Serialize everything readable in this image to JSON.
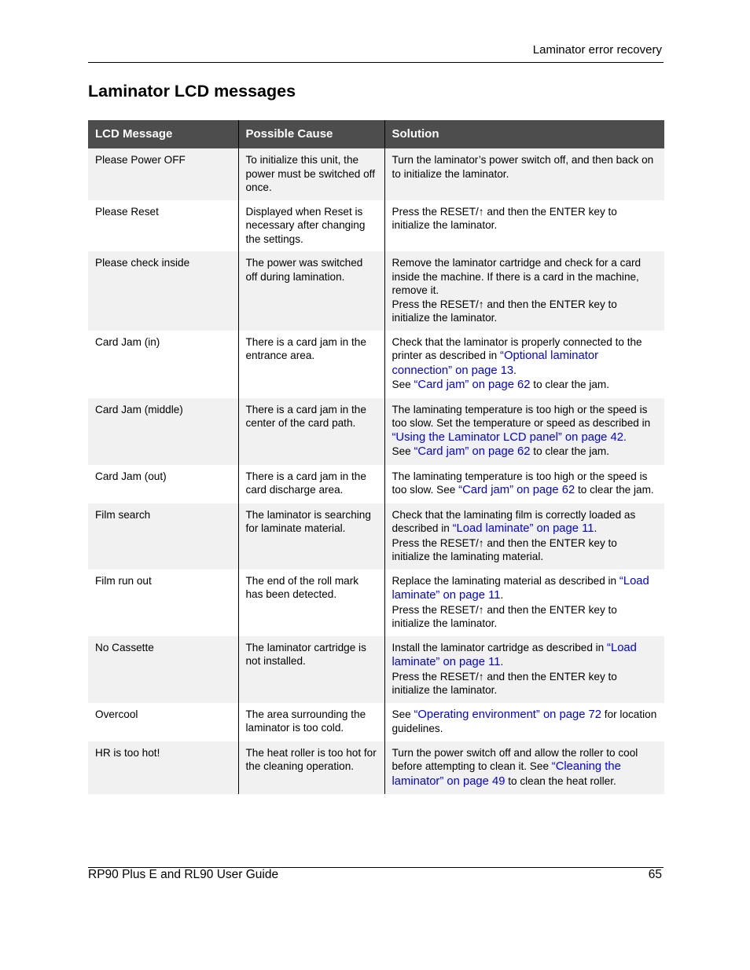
{
  "header": {
    "section": "Laminator error recovery"
  },
  "title": "Laminator LCD messages",
  "table": {
    "columns": [
      "LCD Message",
      "Possible Cause",
      "Solution"
    ],
    "rows": [
      {
        "message": "Please Power OFF",
        "cause": "To initialize this unit, the power must be switched off once.",
        "solution": [
          [
            {
              "t": "Turn the laminator’s power switch off, and then back on to initialize the laminator."
            }
          ]
        ]
      },
      {
        "message": "Please Reset",
        "cause": "Displayed when Reset is necessary after changing the settings.",
        "solution": [
          [
            {
              "t": "Press the RESET/↑ and then the ENTER key to initialize the laminator."
            }
          ]
        ]
      },
      {
        "message": "Please check inside",
        "cause": "The power was switched off during lamination.",
        "solution": [
          [
            {
              "t": "Remove the laminator cartridge and check for a card inside the machine. If there is a card in the machine, remove it."
            }
          ],
          [
            {
              "t": "Press the RESET/↑ and then the ENTER key to initialize the laminator."
            }
          ]
        ]
      },
      {
        "message": "Card Jam (in)",
        "cause": "There is a card jam in the entrance area.",
        "solution": [
          [
            {
              "t": "Check that the laminator is properly connected to the printer as described in "
            },
            {
              "t": "“Optional laminator connection” on page 13",
              "link": true
            },
            {
              "t": "."
            }
          ],
          [
            {
              "t": "See "
            },
            {
              "t": "“Card jam” on page 62",
              "link": true
            },
            {
              "t": " to clear the jam."
            }
          ]
        ]
      },
      {
        "message": "Card Jam (middle)",
        "cause": "There is a card jam in the center of the card path.",
        "solution": [
          [
            {
              "t": "The laminating temperature is too high or the speed is too slow. Set the temperature or speed as described in "
            },
            {
              "t": "“Using the Laminator LCD panel” on page 42",
              "link": true
            },
            {
              "t": "."
            }
          ],
          [
            {
              "t": "See "
            },
            {
              "t": "“Card jam” on page 62",
              "link": true
            },
            {
              "t": " to clear the jam."
            }
          ]
        ]
      },
      {
        "message": "Card Jam (out)",
        "cause": "There is a card jam in the card discharge area.",
        "solution": [
          [
            {
              "t": "The laminating temperature is too high or the speed is too slow. See "
            },
            {
              "t": "“Card jam” on page 62",
              "link": true
            },
            {
              "t": " to clear the jam."
            }
          ]
        ]
      },
      {
        "message": "Film search",
        "cause": "The laminator is searching for laminate material.",
        "solution": [
          [
            {
              "t": "Check that the laminating film is correctly loaded as described in "
            },
            {
              "t": "“Load laminate” on page 11",
              "link": true
            },
            {
              "t": "."
            }
          ],
          [
            {
              "t": "Press the RESET/↑ and then the ENTER key to initialize the laminating material."
            }
          ]
        ]
      },
      {
        "message": "Film run out",
        "cause": "The end of the roll mark has been detected.",
        "solution": [
          [
            {
              "t": "Replace the laminating material as described in "
            },
            {
              "t": "“Load laminate” on page 11",
              "link": true
            },
            {
              "t": "."
            }
          ],
          [
            {
              "t": "Press the RESET/↑ and then the ENTER key to initialize the laminator."
            }
          ]
        ]
      },
      {
        "message": "No Cassette",
        "cause": "The laminator cartridge is not installed.",
        "solution": [
          [
            {
              "t": "Install the laminator cartridge as described in "
            },
            {
              "t": "“Load laminate” on page 11",
              "link": true
            },
            {
              "t": "."
            }
          ],
          [
            {
              "t": "Press the RESET/↑ and then the ENTER key to initialize the laminator."
            }
          ]
        ]
      },
      {
        "message": "Overcool",
        "cause": "The area surrounding the laminator is too cold.",
        "solution": [
          [
            {
              "t": "See "
            },
            {
              "t": "“Operating environment” on page 72",
              "link": true
            },
            {
              "t": " for location guidelines."
            }
          ]
        ]
      },
      {
        "message": "HR is too hot!",
        "cause": "The heat roller is too hot for the cleaning operation.",
        "solution": [
          [
            {
              "t": "Turn the power switch off and allow the roller to cool before attempting to clean it. See "
            },
            {
              "t": "“Cleaning the laminator” on page 49",
              "link": true
            },
            {
              "t": " to clean the heat roller."
            }
          ]
        ]
      }
    ]
  },
  "footer": {
    "guide_title": "RP90 Plus E and RL90 User Guide",
    "page_number": "65"
  },
  "colors": {
    "header_bg": "#4d4d4d",
    "shaded_row": "#f1f1f1",
    "link": "#0000ee"
  }
}
